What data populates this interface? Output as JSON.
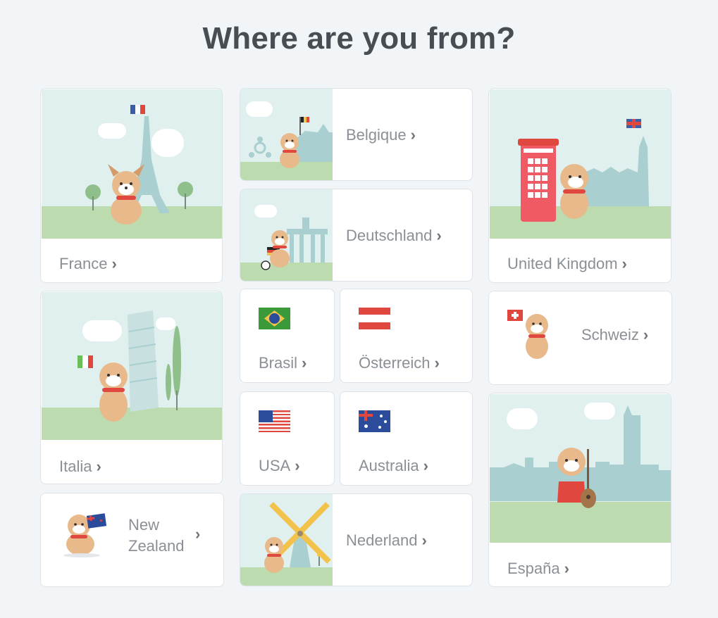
{
  "page": {
    "title": "Where are you from?"
  },
  "countries": {
    "france": {
      "label": "France"
    },
    "belgique": {
      "label": "Belgique"
    },
    "deutschland": {
      "label": "Deutschland"
    },
    "uk": {
      "label": "United Kingdom"
    },
    "italia": {
      "label": "Italia"
    },
    "brasil": {
      "label": "Brasil"
    },
    "osterreich": {
      "label": "Österreich"
    },
    "schweiz": {
      "label": "Schweiz"
    },
    "usa": {
      "label": "USA"
    },
    "australia": {
      "label": "Australia"
    },
    "espana": {
      "label": "España"
    },
    "new_zealand": {
      "label_line1": "New",
      "label_line2": "Zealand"
    },
    "nederland": {
      "label": "Nederland"
    }
  },
  "colors": {
    "scene_sky": "#dff0ee",
    "grass": "#bcdcb0",
    "dog": "#e8b98b",
    "scarf": "#e0483f",
    "landmark": "#a9cfd0"
  },
  "icons": [
    "chevron-right-icon",
    "dog-mascot-icon",
    "flag-icon",
    "eiffel-tower-icon",
    "phone-box-icon",
    "leaning-tower-icon",
    "windmill-icon",
    "brandenburg-gate-icon",
    "atomium-icon"
  ]
}
